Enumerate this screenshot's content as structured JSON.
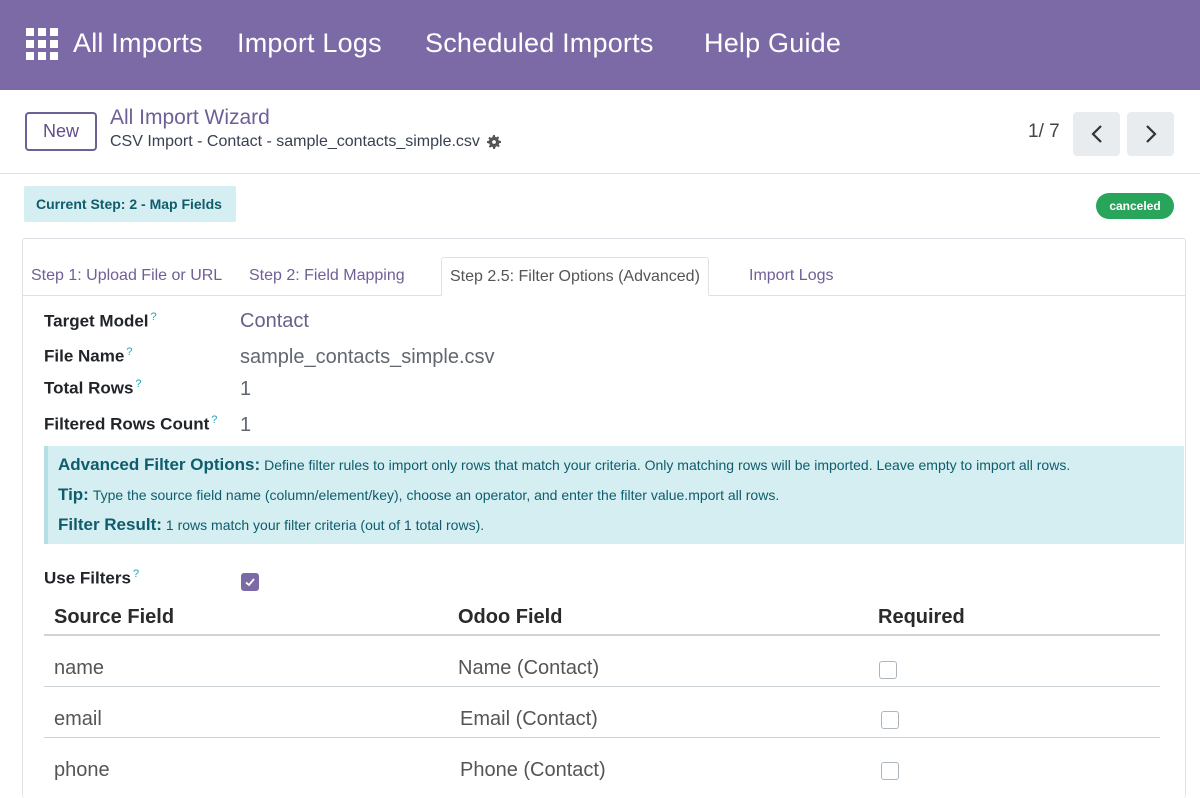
{
  "nav": {
    "items": [
      "All Imports",
      "Import Logs",
      "Scheduled Imports",
      "Help Guide"
    ]
  },
  "control": {
    "new_label": "New",
    "breadcrumb_title": "All Import Wizard",
    "breadcrumb_subtitle": "CSV Import - Contact - sample_contacts_simple.csv",
    "pager": "1/ 7"
  },
  "status": {
    "current_step": "Current Step: 2 - Map Fields",
    "state": "canceled"
  },
  "tabs": [
    {
      "label": "Step 1: Upload File or URL",
      "active": false
    },
    {
      "label": "Step 2: Field Mapping",
      "active": false
    },
    {
      "label": "Step 2.5: Filter Options (Advanced)",
      "active": true
    },
    {
      "label": "Import Logs",
      "active": false
    }
  ],
  "fields": {
    "target_model": {
      "label": "Target Model",
      "help": "?",
      "value": "Contact"
    },
    "file_name": {
      "label": "File Name",
      "help": "?",
      "value": "sample_contacts_simple.csv"
    },
    "total_rows": {
      "label": "Total Rows",
      "help": "?",
      "value": "1"
    },
    "filtered_rows": {
      "label": "Filtered Rows Count",
      "help": "?",
      "value": "1"
    },
    "use_filters": {
      "label": "Use Filters",
      "help": "?",
      "checked": true
    }
  },
  "alert": {
    "line1_title": "Advanced Filter Options:",
    "line1_text": "Define filter rules to import only rows that match your criteria. Only matching rows will be imported. Leave empty to import all rows.",
    "line2_title": "Tip:",
    "line2_text": "Type the source field name (column/element/key), choose an operator, and enter the filter value.mport all rows.",
    "line3_title": "Filter Result:",
    "line3_text": "1 rows match your filter criteria (out of 1 total rows)."
  },
  "table": {
    "headers": [
      "Source Field",
      "Odoo Field",
      "Required"
    ],
    "rows": [
      {
        "source": "name",
        "odoo": "Name (Contact)",
        "required": false
      },
      {
        "source": "email",
        "odoo": "Email (Contact)",
        "required": false
      },
      {
        "source": "phone",
        "odoo": "Phone (Contact)",
        "required": false
      }
    ]
  },
  "colors": {
    "brand": "#7c6aa6",
    "info_bg": "#d4eef1",
    "success": "#28a55b"
  }
}
